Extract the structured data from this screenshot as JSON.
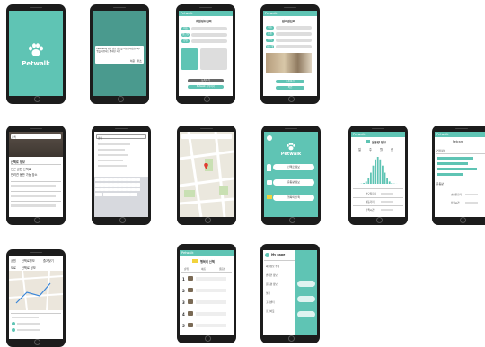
{
  "brand": {
    "name": "Petwalk",
    "teal": "#5fc4b4",
    "dark_teal": "#4a9a8e",
    "paw_icon": "paw-icon"
  },
  "screen2": {
    "dialog_text": "Petwalk에 위치 정보 접근을 허용하시겠습니까? 앱을 사용하는 중에만 허용",
    "allow": "허용",
    "cancel": "취소"
  },
  "screen3": {
    "title": "회원정보입력",
    "fields": [
      "이름",
      "생년월일",
      "성별",
      "종류",
      "연락처"
    ],
    "btn1": "등록하기",
    "btn2": "Petwalk 시작하기"
  },
  "screen4": {
    "title": "반려견입력",
    "fields": [
      "이름",
      "품종",
      "나이",
      "몸무게"
    ],
    "btn1": "등록하기",
    "btn2": "확인"
  },
  "screen5": {
    "search": "검색",
    "lines": [
      "산책로 정보",
      "인근 공원 산책로",
      "반려견 동반 가능 장소"
    ]
  },
  "screen9": {
    "title": "운동량 정보",
    "tabs": [
      "일",
      "주",
      "월",
      "년"
    ],
    "rows": [
      "소모칼로리",
      "이동거리",
      "산책시간"
    ]
  },
  "screen10": {
    "app": "Petcare",
    "section1": "건강정보",
    "section2": "운동량",
    "rows": [
      "소모칼로리",
      "산책시간"
    ]
  },
  "screen8": {
    "menu": [
      "산책로 정보",
      "운동량 정보",
      "행복의 산책"
    ]
  },
  "screen11": {
    "tabs": [
      "공원",
      "산책로정보",
      "즐겨찾기"
    ],
    "subtabs": [
      "도로",
      "산책로 정보"
    ]
  },
  "screen12": {
    "title": "행복의 산책",
    "cols": [
      "순위",
      "이름",
      "걸음수"
    ],
    "ranks": [
      "1",
      "2",
      "3",
      "4",
      "5"
    ]
  },
  "screen13": {
    "title": "My page",
    "menu": [
      "회원정보 수정",
      "반려견 정보",
      "운동량 정보",
      "설정",
      "고객센터",
      "로그아웃"
    ]
  }
}
